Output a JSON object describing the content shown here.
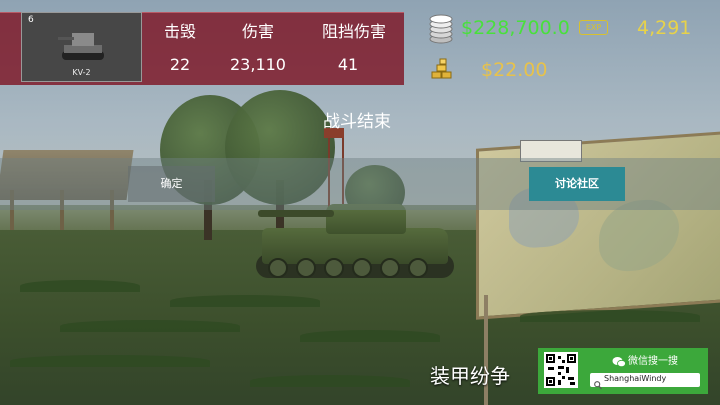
{
  "vehicle": {
    "tier": "6",
    "name": "KV-2"
  },
  "stats": {
    "kills_label": "击毁",
    "kills_value": "22",
    "damage_label": "伤害",
    "damage_value": "23,110",
    "blocked_label": "阻挡伤害",
    "blocked_value": "41"
  },
  "currency": {
    "credits": "$228,700.0",
    "exp_badge": "EXP",
    "exp": "4,291",
    "gold": "$22.00"
  },
  "result": {
    "title": "战斗结束"
  },
  "buttons": {
    "confirm": "确定",
    "discuss": "讨论社区"
  },
  "watermark": {
    "game_title": "装甲纷争",
    "wechat_label": "微信搜一搜",
    "search_text": "ShanghaiWindy"
  },
  "colors": {
    "panel": "#7e1626",
    "credits": "#49e03c",
    "exp": "#e7d24a",
    "discuss_button": "#2c8a94",
    "wechat": "#3ca83b"
  },
  "icons": {
    "credits": "coin-stack-icon",
    "gold": "gold-bars-icon",
    "vehicle": "tank-icon",
    "wechat": "wechat-icon",
    "search": "search-icon"
  }
}
